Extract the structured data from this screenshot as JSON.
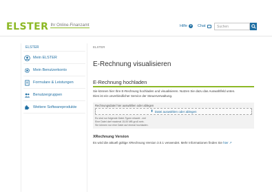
{
  "header": {
    "logo": "ELSTER",
    "logo_sub": "Ihr Online-Finanzamt",
    "help_label": "Hilfe",
    "chat_label": "Chat",
    "search_placeholder": "Suchen"
  },
  "sidebar": {
    "title": "ELSTER",
    "items": [
      {
        "label": "Mein ELSTER",
        "icon": "person-circle-icon"
      },
      {
        "label": "Mein Benutzerkonto",
        "icon": "gear-icon"
      },
      {
        "label": "Formulare & Leistungen",
        "icon": "document-icon"
      },
      {
        "label": "Benutzergruppen",
        "icon": "group-icon"
      },
      {
        "label": "Weitere Softwareprodukte",
        "icon": "puzzle-icon"
      }
    ]
  },
  "main": {
    "breadcrumb": "ELSTER",
    "page_title": "E-Rechnung visualisieren",
    "section_title": "E-Rechnung hochladen",
    "description_1": "Sie können hier Ihre E-Rechnung hochladen und visualisieren. Nutzen Sie dazu das Auswahlfeld unten.",
    "description_2": "Dies ist ein unverbindlicher Service der Steuerverwaltung.",
    "upload_label": "Rechnungsdatei hier auswählen oder ablegen",
    "dropzone_label": "Datei auswählen oder ablegen",
    "hints": [
      "Es sind nur folgende Datei-Typen erlaubt: .xml",
      "Eine Datei darf maximal 15,00 MB groß sein.",
      "Sie können nur eine Datei auf einmal hochladen."
    ],
    "xrechnung_title": "XRechnung Version",
    "xrechnung_text": "Es wird die aktuell gültige XRechnung Version 3.0.1 verwendet. Mehr Informationen finden Sie",
    "xrechnung_link": "hier"
  },
  "colors": {
    "accent_green": "#8cb825",
    "link_blue": "#1f6fa3"
  }
}
